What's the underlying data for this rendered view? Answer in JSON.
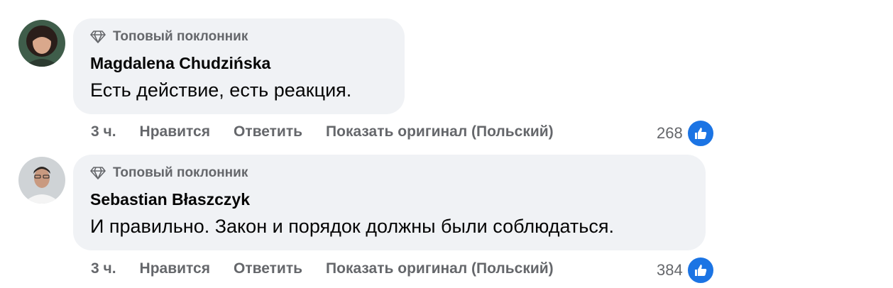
{
  "comments": [
    {
      "badge": "Топовый поклонник",
      "author": "Magdalena Chudzińska",
      "text": "Есть действие, есть реакция.",
      "time": "3 ч.",
      "like_label": "Нравится",
      "reply_label": "Ответить",
      "translate_label": "Показать оригинал (Польский)",
      "reaction_count": "268",
      "reaction_icon": "like-icon"
    },
    {
      "badge": "Топовый поклонник",
      "author": "Sebastian Błaszczyk",
      "text": "И правильно. Закон и порядок должны были соблюдаться.",
      "time": "3 ч.",
      "like_label": "Нравится",
      "reply_label": "Ответить",
      "translate_label": "Показать оригинал (Польский)",
      "reaction_count": "384",
      "reaction_icon": "like-icon"
    }
  ],
  "colors": {
    "bubble": "#f0f2f5",
    "muted_text": "#65676b",
    "primary_text": "#050505",
    "like_blue": "#1b74e4"
  }
}
